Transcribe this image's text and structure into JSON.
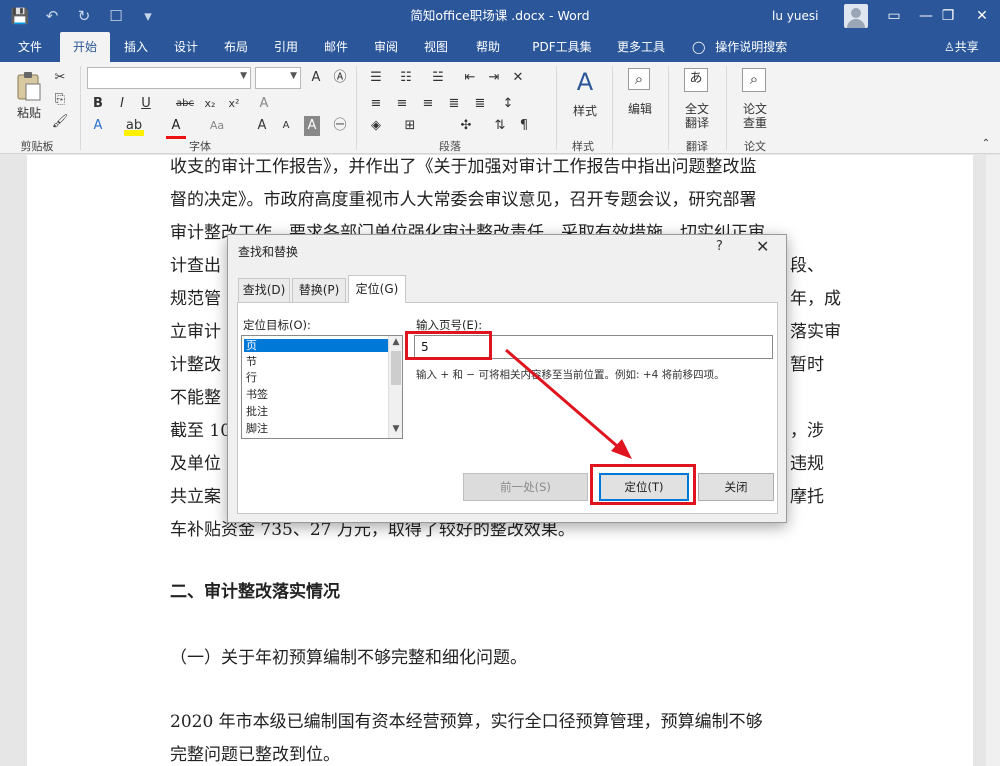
{
  "window": {
    "title": "简知office职场课 .docx  -  Word",
    "user": "lu yuesi",
    "min_icon": "minimize-icon",
    "restore_icon": "restore-icon",
    "close_icon": "close-icon",
    "min_glyph": "—",
    "restore_glyph": "❐",
    "close_glyph": "✕"
  },
  "qat": {
    "save_glyph": "💾",
    "undo_glyph": "↶",
    "redo_glyph": "↻",
    "touch_glyph": "☐",
    "more_glyph": "▾"
  },
  "tabs": [
    {
      "label": "文件"
    },
    {
      "label": "开始"
    },
    {
      "label": "插入"
    },
    {
      "label": "设计"
    },
    {
      "label": "布局"
    },
    {
      "label": "引用"
    },
    {
      "label": "邮件"
    },
    {
      "label": "审阅"
    },
    {
      "label": "视图"
    },
    {
      "label": "帮助"
    },
    {
      "label": "PDF工具集"
    },
    {
      "label": "更多工具"
    }
  ],
  "tell_me": "操作说明搜索",
  "share": "共享",
  "ribbon": {
    "clipboard": {
      "paste": "粘贴",
      "label": "剪贴板"
    },
    "font": {
      "label": "字体",
      "bold": "B",
      "italic": "I",
      "underline": "U",
      "strike": "abc",
      "sub": "x₂",
      "sup": "x²",
      "font_color": "A",
      "grow": "A",
      "shrink": "A",
      "aa": "Aa"
    },
    "paragraph": {
      "label": "段落"
    },
    "styles": {
      "button": "样式",
      "label": "样式"
    },
    "editing": {
      "button": "编辑"
    },
    "translate": {
      "button_line1": "全文",
      "button_line2": "翻译",
      "label": "翻译"
    },
    "paper": {
      "button_line1": "论文",
      "button_line2": "查重",
      "label": "论文"
    }
  },
  "document": {
    "lines": [
      "收支的审计工作报告》，并作出了《关于加强对审计工作报告中指出问题整改监",
      "督的决定》。市政府高度重视市人大常委会审议意见，召开专题会议，研究部署",
      "审计整改工作，要求各部门单位强化审计整改责任，采取有效措施，切实纠正审",
      "计查出",
      "规范管",
      "立审计",
      "计整改",
      "不能整",
      "截至 10",
      "及单位",
      "共立案",
      "车补贴资金 735、27 万元，取得了较好的整改效果。"
    ],
    "line_right_fragments": [
      "段、",
      "年，成",
      "落实审",
      "暂时",
      "，涉",
      "违规",
      "摩托"
    ],
    "heading": "二、审计整改落实情况",
    "subheading": "（一）关于年初预算编制不够完整和细化问题。",
    "para2_line1": "2020 年市本级已编制国有资本经营预算，实行全口径预算管理，预算编制不够",
    "para2_line2": "完整问题已整改到位。"
  },
  "dialog": {
    "title": "查找和替换",
    "help": "?",
    "close": "✕",
    "tabs": [
      {
        "label": "查找(D)"
      },
      {
        "label": "替换(P)"
      },
      {
        "label": "定位(G)"
      }
    ],
    "target_label": "定位目标(O):",
    "targets": [
      "页",
      "节",
      "行",
      "书签",
      "批注",
      "脚注"
    ],
    "page_label": "输入页号(E):",
    "page_value": "5",
    "hint": "输入 + 和 − 可将相关内容移至当前位置。例如: +4 将前移四项。",
    "prev_button": "前一处(S)",
    "goto_button": "定位(T)",
    "close_button": "关闭",
    "annotation_color": "#e0141e"
  }
}
